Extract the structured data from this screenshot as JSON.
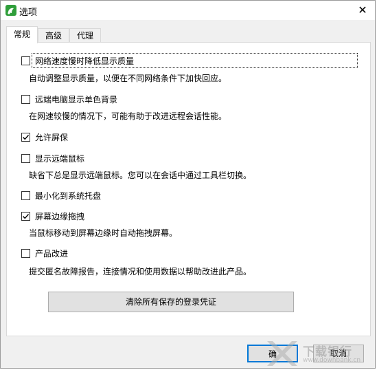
{
  "window": {
    "title": "选项",
    "close_glyph": "✕"
  },
  "tabs": [
    {
      "label": "常规",
      "active": true
    },
    {
      "label": "高级",
      "active": false
    },
    {
      "label": "代理",
      "active": false
    }
  ],
  "options": [
    {
      "label": "网络速度慢时降低显示质量",
      "checked": false,
      "description": "自动调整显示质量，以便在不同网络条件下加快回应。"
    },
    {
      "label": "远端电脑显示单色背景",
      "checked": false,
      "description": "在网速较慢的情况下，可能有助于改进远程会话性能。"
    },
    {
      "label": "允许屏保",
      "checked": true,
      "description": ""
    },
    {
      "label": "显示远端鼠标",
      "checked": false,
      "description": "缺省下总是显示远端鼠标。您可以在会话中通过工具栏切换。"
    },
    {
      "label": "最小化到系统托盘",
      "checked": false,
      "description": ""
    },
    {
      "label": "屏幕边缘拖拽",
      "checked": true,
      "description": "当鼠标移动到屏幕边缘时自动拖拽屏幕。"
    },
    {
      "label": "产品改进",
      "checked": false,
      "description": "提交匿名故障报告，连接情况和使用数据以帮助改进此产品。"
    }
  ],
  "clear_button": "清除所有保存的登录凭证",
  "footer": {
    "ok_label": "确",
    "cancel_label": "取消"
  },
  "watermark": {
    "text": "下载银行",
    "url": "www.downbank.cn"
  },
  "colors": {
    "accent": "#0078d7",
    "app_icon": "#2f9e3a"
  }
}
